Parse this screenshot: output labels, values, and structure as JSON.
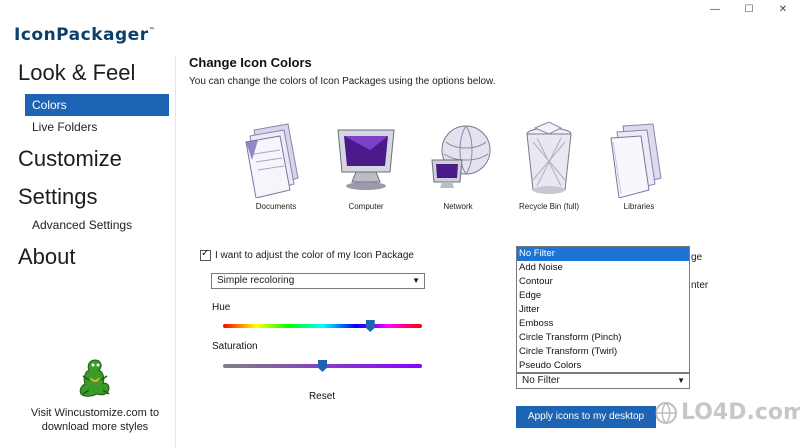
{
  "window": {
    "minimize": "—",
    "maximize": "☐",
    "close": "✕"
  },
  "logo": {
    "text": "IconPackager",
    "tm": "™"
  },
  "sidebar": {
    "look_feel": "Look & Feel",
    "colors": "Colors",
    "live_folders": "Live Folders",
    "customize": "Customize",
    "settings": "Settings",
    "advanced_settings": "Advanced Settings",
    "about": "About",
    "promo_line1": "Visit Wincustomize.com to",
    "promo_line2": "download more styles"
  },
  "main": {
    "title": "Change Icon Colors",
    "subtitle": "You can change the colors of Icon Packages using the options below.",
    "icons": [
      {
        "label": "Documents",
        "icon": "documents-icon"
      },
      {
        "label": "Computer",
        "icon": "computer-icon"
      },
      {
        "label": "Network",
        "icon": "network-icon"
      },
      {
        "label": "Recycle Bin (full)",
        "icon": "recycle-bin-icon"
      },
      {
        "label": "Libraries",
        "icon": "libraries-icon"
      }
    ],
    "adjust_checkbox": "I want to adjust the color of my Icon Package",
    "adjust_checked": true,
    "recolor_mode": "Simple recoloring",
    "hue_label": "Hue",
    "hue_value": 0.74,
    "saturation_label": "Saturation",
    "saturation_value": 0.5,
    "reset": "Reset",
    "filter_options": [
      "No Filter",
      "Add Noise",
      "Contour",
      "Edge",
      "Jitter",
      "Emboss",
      "Circle Transform (Pinch)",
      "Circle Transform (Twirl)",
      "Pseudo Colors"
    ],
    "filter_selected": "No Filter",
    "peek_1": "ge",
    "peek_2": "nter",
    "apply": "Apply icons to my desktop"
  },
  "watermark": "LO4D.com",
  "colors": {
    "accent": "#1e64b4",
    "selection": "#1e73d6"
  }
}
